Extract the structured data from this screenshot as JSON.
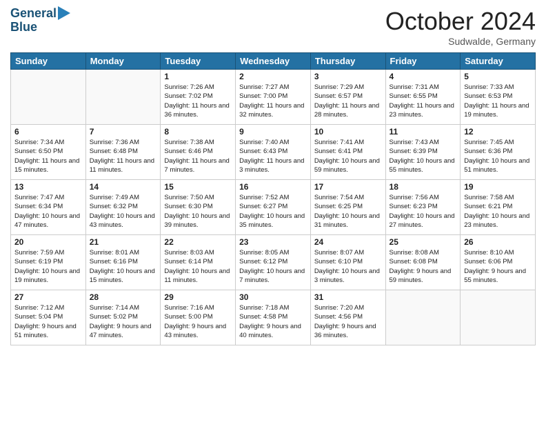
{
  "header": {
    "logo_line1": "General",
    "logo_line2": "Blue",
    "month": "October 2024",
    "location": "Sudwalde, Germany"
  },
  "weekdays": [
    "Sunday",
    "Monday",
    "Tuesday",
    "Wednesday",
    "Thursday",
    "Friday",
    "Saturday"
  ],
  "weeks": [
    [
      {
        "day": "",
        "text": ""
      },
      {
        "day": "",
        "text": ""
      },
      {
        "day": "1",
        "text": "Sunrise: 7:26 AM\nSunset: 7:02 PM\nDaylight: 11 hours and 36 minutes."
      },
      {
        "day": "2",
        "text": "Sunrise: 7:27 AM\nSunset: 7:00 PM\nDaylight: 11 hours and 32 minutes."
      },
      {
        "day": "3",
        "text": "Sunrise: 7:29 AM\nSunset: 6:57 PM\nDaylight: 11 hours and 28 minutes."
      },
      {
        "day": "4",
        "text": "Sunrise: 7:31 AM\nSunset: 6:55 PM\nDaylight: 11 hours and 23 minutes."
      },
      {
        "day": "5",
        "text": "Sunrise: 7:33 AM\nSunset: 6:53 PM\nDaylight: 11 hours and 19 minutes."
      }
    ],
    [
      {
        "day": "6",
        "text": "Sunrise: 7:34 AM\nSunset: 6:50 PM\nDaylight: 11 hours and 15 minutes."
      },
      {
        "day": "7",
        "text": "Sunrise: 7:36 AM\nSunset: 6:48 PM\nDaylight: 11 hours and 11 minutes."
      },
      {
        "day": "8",
        "text": "Sunrise: 7:38 AM\nSunset: 6:46 PM\nDaylight: 11 hours and 7 minutes."
      },
      {
        "day": "9",
        "text": "Sunrise: 7:40 AM\nSunset: 6:43 PM\nDaylight: 11 hours and 3 minutes."
      },
      {
        "day": "10",
        "text": "Sunrise: 7:41 AM\nSunset: 6:41 PM\nDaylight: 10 hours and 59 minutes."
      },
      {
        "day": "11",
        "text": "Sunrise: 7:43 AM\nSunset: 6:39 PM\nDaylight: 10 hours and 55 minutes."
      },
      {
        "day": "12",
        "text": "Sunrise: 7:45 AM\nSunset: 6:36 PM\nDaylight: 10 hours and 51 minutes."
      }
    ],
    [
      {
        "day": "13",
        "text": "Sunrise: 7:47 AM\nSunset: 6:34 PM\nDaylight: 10 hours and 47 minutes."
      },
      {
        "day": "14",
        "text": "Sunrise: 7:49 AM\nSunset: 6:32 PM\nDaylight: 10 hours and 43 minutes."
      },
      {
        "day": "15",
        "text": "Sunrise: 7:50 AM\nSunset: 6:30 PM\nDaylight: 10 hours and 39 minutes."
      },
      {
        "day": "16",
        "text": "Sunrise: 7:52 AM\nSunset: 6:27 PM\nDaylight: 10 hours and 35 minutes."
      },
      {
        "day": "17",
        "text": "Sunrise: 7:54 AM\nSunset: 6:25 PM\nDaylight: 10 hours and 31 minutes."
      },
      {
        "day": "18",
        "text": "Sunrise: 7:56 AM\nSunset: 6:23 PM\nDaylight: 10 hours and 27 minutes."
      },
      {
        "day": "19",
        "text": "Sunrise: 7:58 AM\nSunset: 6:21 PM\nDaylight: 10 hours and 23 minutes."
      }
    ],
    [
      {
        "day": "20",
        "text": "Sunrise: 7:59 AM\nSunset: 6:19 PM\nDaylight: 10 hours and 19 minutes."
      },
      {
        "day": "21",
        "text": "Sunrise: 8:01 AM\nSunset: 6:16 PM\nDaylight: 10 hours and 15 minutes."
      },
      {
        "day": "22",
        "text": "Sunrise: 8:03 AM\nSunset: 6:14 PM\nDaylight: 10 hours and 11 minutes."
      },
      {
        "day": "23",
        "text": "Sunrise: 8:05 AM\nSunset: 6:12 PM\nDaylight: 10 hours and 7 minutes."
      },
      {
        "day": "24",
        "text": "Sunrise: 8:07 AM\nSunset: 6:10 PM\nDaylight: 10 hours and 3 minutes."
      },
      {
        "day": "25",
        "text": "Sunrise: 8:08 AM\nSunset: 6:08 PM\nDaylight: 9 hours and 59 minutes."
      },
      {
        "day": "26",
        "text": "Sunrise: 8:10 AM\nSunset: 6:06 PM\nDaylight: 9 hours and 55 minutes."
      }
    ],
    [
      {
        "day": "27",
        "text": "Sunrise: 7:12 AM\nSunset: 5:04 PM\nDaylight: 9 hours and 51 minutes."
      },
      {
        "day": "28",
        "text": "Sunrise: 7:14 AM\nSunset: 5:02 PM\nDaylight: 9 hours and 47 minutes."
      },
      {
        "day": "29",
        "text": "Sunrise: 7:16 AM\nSunset: 5:00 PM\nDaylight: 9 hours and 43 minutes."
      },
      {
        "day": "30",
        "text": "Sunrise: 7:18 AM\nSunset: 4:58 PM\nDaylight: 9 hours and 40 minutes."
      },
      {
        "day": "31",
        "text": "Sunrise: 7:20 AM\nSunset: 4:56 PM\nDaylight: 9 hours and 36 minutes."
      },
      {
        "day": "",
        "text": ""
      },
      {
        "day": "",
        "text": ""
      }
    ]
  ]
}
